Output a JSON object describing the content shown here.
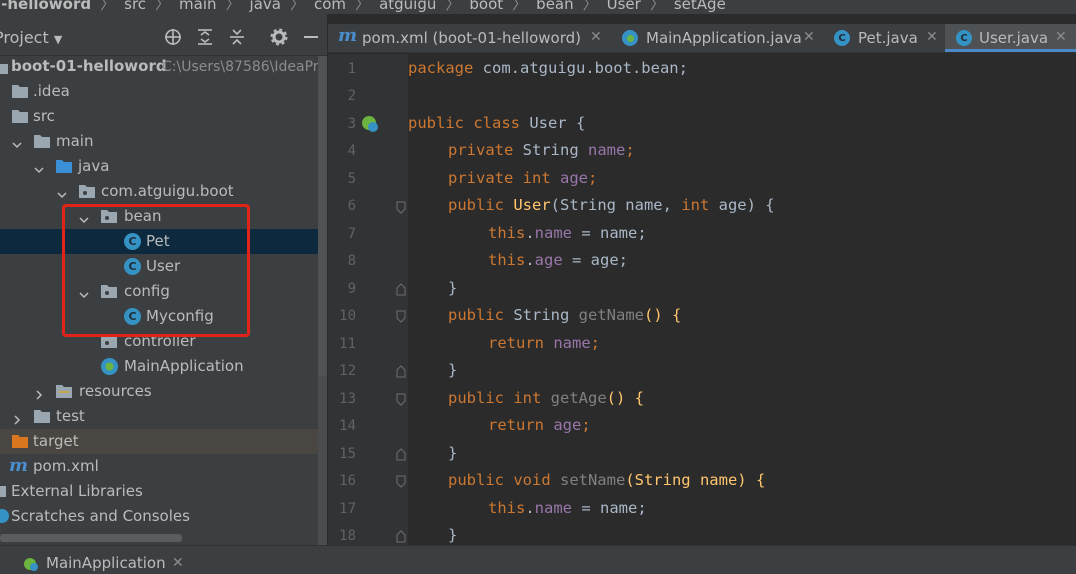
{
  "breadcrumb": [
    "l-helloword",
    "src",
    "main",
    "java",
    "com",
    "atguigu",
    "boot",
    "bean",
    "User",
    "setAge"
  ],
  "project": {
    "title": "Project",
    "toolbar_icons": [
      "locate-icon",
      "expand-all-icon",
      "collapse-all-icon",
      "gear-icon",
      "minimize-icon"
    ]
  },
  "tree": {
    "root_name": "boot-01-helloword",
    "root_path": "C:\\Users\\87586\\IdeaPro",
    "idea": ".idea",
    "src": "src",
    "main": "main",
    "java": "java",
    "package": "com.atguigu.boot",
    "bean": "bean",
    "pet": "Pet",
    "user": "User",
    "config": "config",
    "myconfig": "Myconfig",
    "controller": "controller",
    "mainapp": "MainApplication",
    "resources": "resources",
    "test": "test",
    "target": "target",
    "pom": "pom.xml",
    "external": "External Libraries",
    "scratches": "Scratches and Consoles"
  },
  "tabs": [
    {
      "label": "pom.xml (boot-01-helloword)",
      "icon": "maven-icon",
      "active": false
    },
    {
      "label": "MainApplication.java",
      "icon": "spring-class-icon",
      "active": false
    },
    {
      "label": "Pet.java",
      "icon": "class-icon",
      "active": false
    },
    {
      "label": "User.java",
      "icon": "class-icon",
      "active": true
    }
  ],
  "editor": {
    "line_numbers": [
      "1",
      "2",
      "3",
      "4",
      "5",
      "6",
      "7",
      "8",
      "9",
      "10",
      "11",
      "12",
      "13",
      "14",
      "15",
      "16",
      "17",
      "18"
    ],
    "code": {
      "l1_kw": "package",
      "l1_rest": " com.atguigu.boot.bean;",
      "l3_kw": "public class",
      "l3_rest": " User {",
      "l4_kw": "private",
      "l4_type": " String ",
      "l4_field": "name",
      "l4_end": ";",
      "l5_kw": "private int ",
      "l5_field": "age",
      "l5_end": ";",
      "l6_kw": "public ",
      "l6_fn": "User",
      "l6_rest": "(String name, ",
      "l6_kw2": "int",
      "l6_rest2": " age) {",
      "l7_kw": "this",
      "l7_dot": ".",
      "l7_field": "name",
      "l7_rest": " = name;",
      "l8_kw": "this",
      "l8_dot": ".",
      "l8_field": "age",
      "l8_rest": " = age;",
      "l9": "}",
      "l10_kw": "public",
      "l10_rest": " String ",
      "l10_fn": "getName",
      "l10_end": "() {",
      "l11_kw": "return ",
      "l11_field": "name",
      "l11_end": ";",
      "l12": "}",
      "l13_kw": "public int ",
      "l13_fn": "getAge",
      "l13_end": "() {",
      "l14_kw": "return ",
      "l14_field": "age",
      "l14_end": ";",
      "l15": "}",
      "l16_kw": "public void ",
      "l16_fn": "setName",
      "l16_end": "(String name) {",
      "l17_kw": "this",
      "l17_dot": ".",
      "l17_field": "name",
      "l17_rest": " = name;",
      "l18": "}"
    }
  },
  "bottom": {
    "run_tab": "MainApplication"
  },
  "colors": {
    "annotation": "#e2231a",
    "selection": "#0d293e",
    "keyword": "#cc7832",
    "field": "#9876aa",
    "function": "#ffc66d"
  }
}
